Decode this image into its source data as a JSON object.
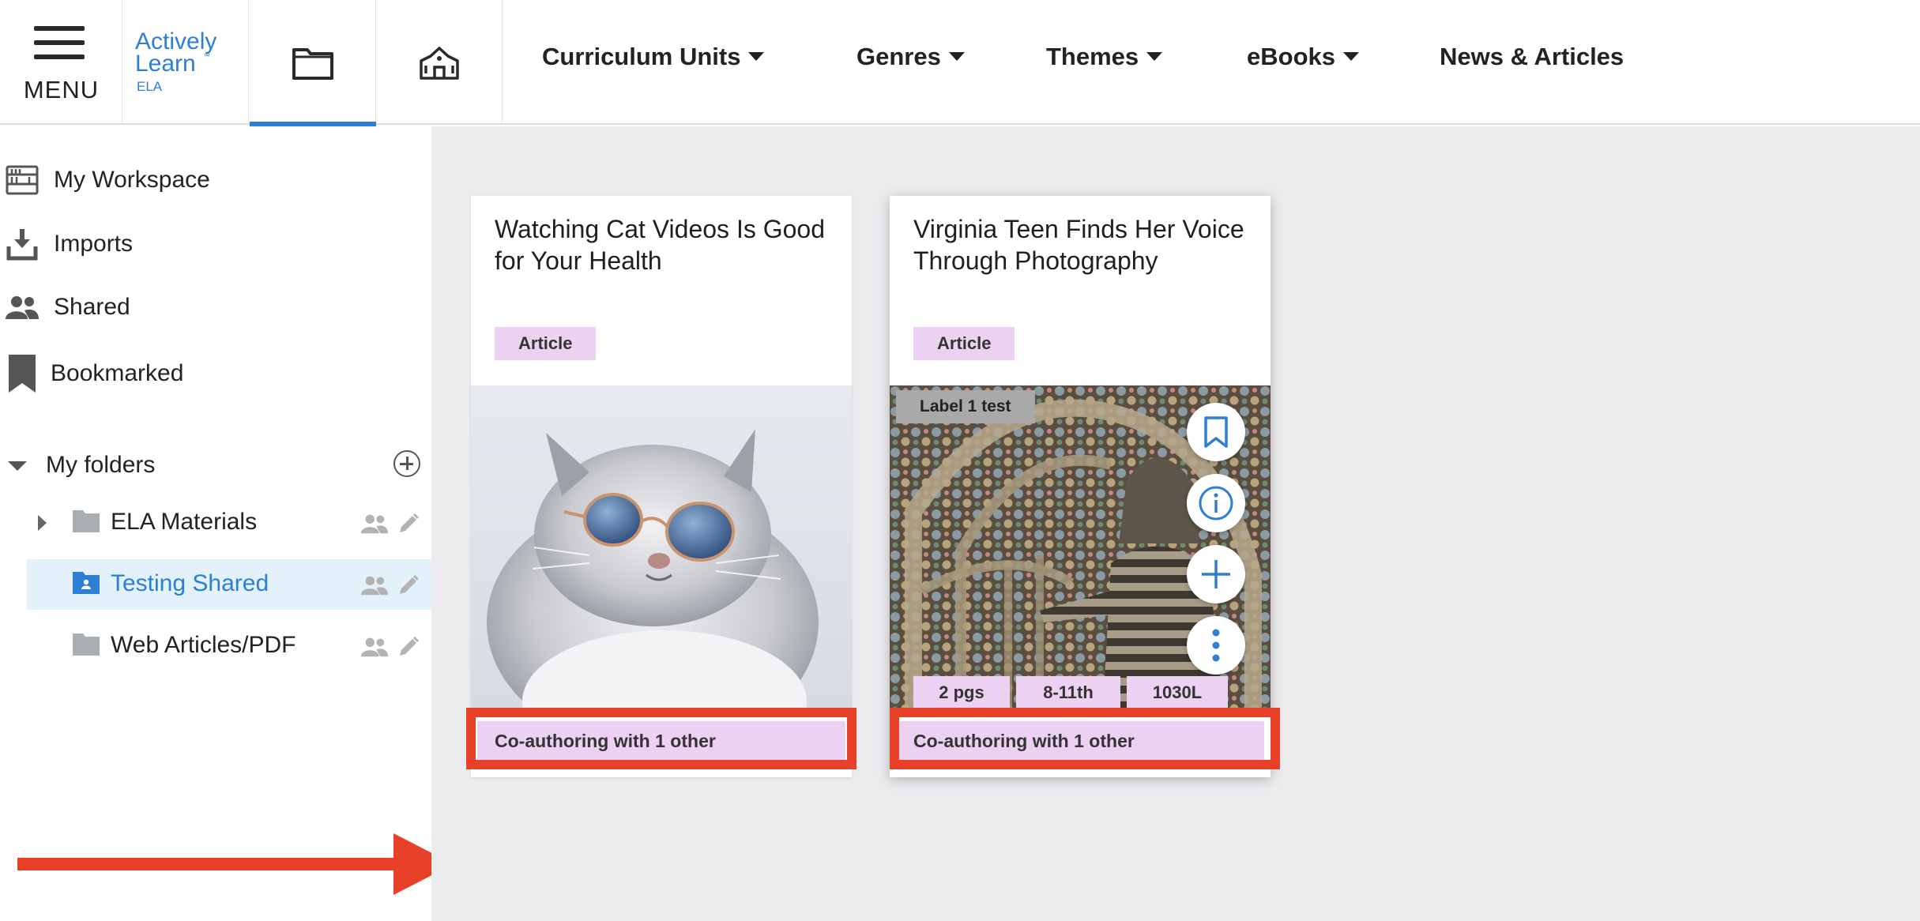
{
  "header": {
    "menu_label": "MENU",
    "logo": {
      "line1": "Actively",
      "line2": "Learn",
      "tm": "™",
      "subtitle": "ELA"
    },
    "icon_tabs": [
      {
        "icon": "folder-icon",
        "active": true
      },
      {
        "icon": "school-icon",
        "active": false
      }
    ],
    "nav": [
      {
        "label": "Curriculum Units",
        "has_dropdown": true
      },
      {
        "label": "Genres",
        "has_dropdown": true
      },
      {
        "label": "Themes",
        "has_dropdown": true
      },
      {
        "label": "eBooks",
        "has_dropdown": true
      },
      {
        "label": "News & Articles",
        "has_dropdown": false
      }
    ]
  },
  "sidebar": {
    "items": [
      {
        "label": "My Workspace",
        "icon": "workspace-icon"
      },
      {
        "label": "Imports",
        "icon": "download-icon"
      },
      {
        "label": "Shared",
        "icon": "people-icon"
      },
      {
        "label": "Bookmarked",
        "icon": "bookmark-icon"
      }
    ],
    "folders_label": "My folders",
    "folders": [
      {
        "name": "ELA Materials",
        "expandable": true,
        "active": false,
        "shared": false
      },
      {
        "name": "Testing Shared",
        "expandable": false,
        "active": true,
        "shared": true
      },
      {
        "name": "Web Articles/PDF",
        "expandable": false,
        "active": false,
        "shared": false
      }
    ]
  },
  "cards": [
    {
      "title": "Watching Cat Videos Is Good for Your Health",
      "type": "Article",
      "image": "cat-with-sunglasses",
      "coauthor": "Co-authoring with 1 other"
    },
    {
      "title": "Virginia Teen Finds Her Voice Through Photography",
      "type": "Article",
      "image": "photography-collage",
      "label": "Label 1 test",
      "meta": [
        "2 pgs",
        "8-11th",
        "1030L"
      ],
      "actions": [
        "bookmark-icon",
        "info-icon",
        "add-icon",
        "more-icon"
      ],
      "coauthor": "Co-authoring with 1 other"
    }
  ],
  "colors": {
    "accent": "#2d7fd3",
    "pill": "#ecd1f2",
    "highlight": "#e8412a",
    "content_bg": "#ececef",
    "active_folder_bg": "#e3f1fb"
  }
}
